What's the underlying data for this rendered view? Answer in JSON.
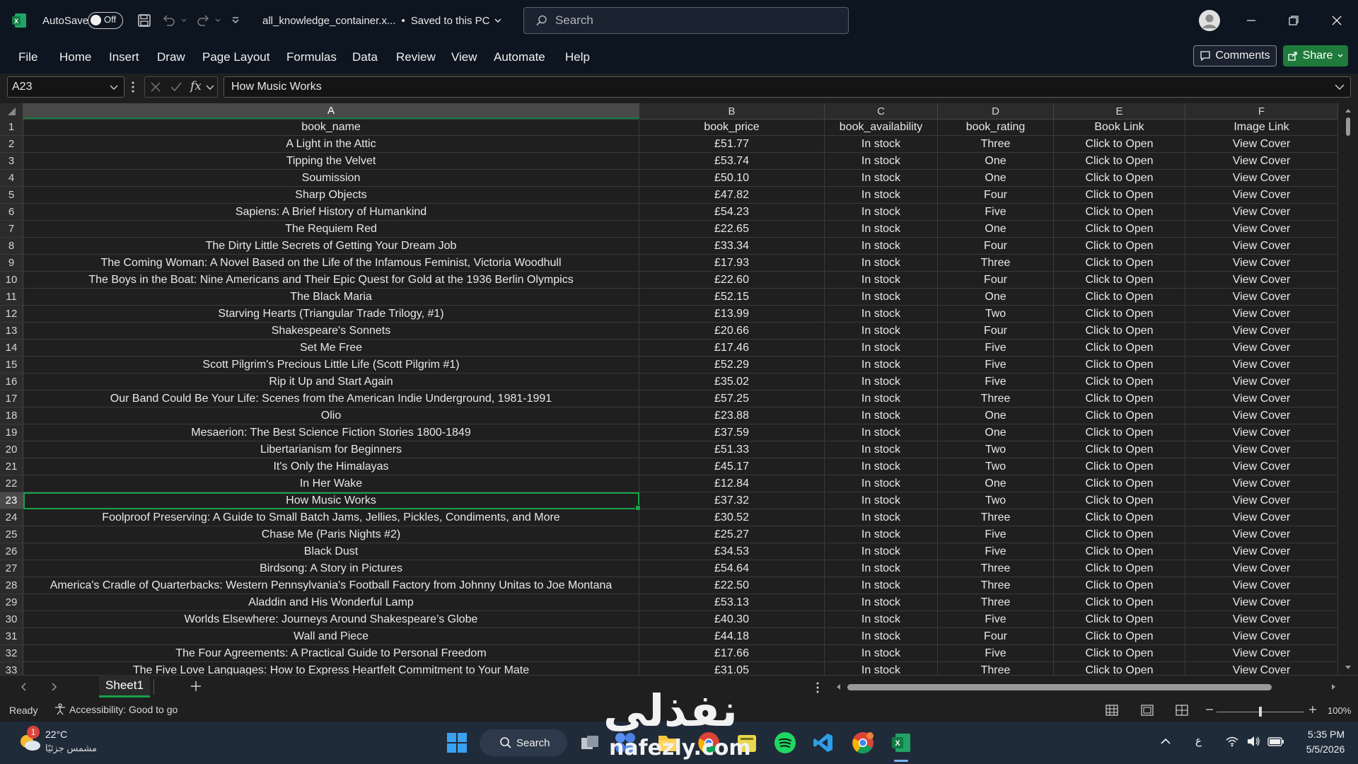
{
  "titlebar": {
    "autosave_label": "AutoSave",
    "autosave_state": "Off",
    "file_name": "all_knowledge_container.x...",
    "save_status": "Saved to this PC",
    "search_placeholder": "Search"
  },
  "ribbon": {
    "tabs": [
      "File",
      "Home",
      "Insert",
      "Draw",
      "Page Layout",
      "Formulas",
      "Data",
      "Review",
      "View",
      "Automate",
      "Help"
    ],
    "comments_label": "Comments",
    "share_label": "Share"
  },
  "formula_bar": {
    "name_box": "A23",
    "fx_label": "fx",
    "content": "How Music Works"
  },
  "grid": {
    "columns": [
      "A",
      "B",
      "C",
      "D",
      "E",
      "F"
    ],
    "selected_column": "A",
    "selected_row": 23,
    "rows": [
      {
        "n": "1",
        "a": "book_name",
        "b": "book_price",
        "c": "book_availability",
        "d": "book_rating",
        "e": "Book Link",
        "f": "Image Link"
      },
      {
        "n": "2",
        "a": "A Light in the Attic",
        "b": "£51.77",
        "c": "In stock",
        "d": "Three",
        "e": "Click to Open",
        "f": "View Cover"
      },
      {
        "n": "3",
        "a": "Tipping the Velvet",
        "b": "£53.74",
        "c": "In stock",
        "d": "One",
        "e": "Click to Open",
        "f": "View Cover"
      },
      {
        "n": "4",
        "a": "Soumission",
        "b": "£50.10",
        "c": "In stock",
        "d": "One",
        "e": "Click to Open",
        "f": "View Cover"
      },
      {
        "n": "5",
        "a": "Sharp Objects",
        "b": "£47.82",
        "c": "In stock",
        "d": "Four",
        "e": "Click to Open",
        "f": "View Cover"
      },
      {
        "n": "6",
        "a": "Sapiens: A Brief History of Humankind",
        "b": "£54.23",
        "c": "In stock",
        "d": "Five",
        "e": "Click to Open",
        "f": "View Cover"
      },
      {
        "n": "7",
        "a": "The Requiem Red",
        "b": "£22.65",
        "c": "In stock",
        "d": "One",
        "e": "Click to Open",
        "f": "View Cover"
      },
      {
        "n": "8",
        "a": "The Dirty Little Secrets of Getting Your Dream Job",
        "b": "£33.34",
        "c": "In stock",
        "d": "Four",
        "e": "Click to Open",
        "f": "View Cover"
      },
      {
        "n": "9",
        "a": "The Coming Woman: A Novel Based on the Life of the Infamous Feminist, Victoria Woodhull",
        "b": "£17.93",
        "c": "In stock",
        "d": "Three",
        "e": "Click to Open",
        "f": "View Cover"
      },
      {
        "n": "10",
        "a": "The Boys in the Boat: Nine Americans and Their Epic Quest for Gold at the 1936 Berlin Olympics",
        "b": "£22.60",
        "c": "In stock",
        "d": "Four",
        "e": "Click to Open",
        "f": "View Cover"
      },
      {
        "n": "11",
        "a": "The Black Maria",
        "b": "£52.15",
        "c": "In stock",
        "d": "One",
        "e": "Click to Open",
        "f": "View Cover"
      },
      {
        "n": "12",
        "a": "Starving Hearts (Triangular Trade Trilogy, #1)",
        "b": "£13.99",
        "c": "In stock",
        "d": "Two",
        "e": "Click to Open",
        "f": "View Cover"
      },
      {
        "n": "13",
        "a": "Shakespeare's Sonnets",
        "b": "£20.66",
        "c": "In stock",
        "d": "Four",
        "e": "Click to Open",
        "f": "View Cover"
      },
      {
        "n": "14",
        "a": "Set Me Free",
        "b": "£17.46",
        "c": "In stock",
        "d": "Five",
        "e": "Click to Open",
        "f": "View Cover"
      },
      {
        "n": "15",
        "a": "Scott Pilgrim's Precious Little Life (Scott Pilgrim #1)",
        "b": "£52.29",
        "c": "In stock",
        "d": "Five",
        "e": "Click to Open",
        "f": "View Cover"
      },
      {
        "n": "16",
        "a": "Rip it Up and Start Again",
        "b": "£35.02",
        "c": "In stock",
        "d": "Five",
        "e": "Click to Open",
        "f": "View Cover"
      },
      {
        "n": "17",
        "a": "Our Band Could Be Your Life: Scenes from the American Indie Underground, 1981-1991",
        "b": "£57.25",
        "c": "In stock",
        "d": "Three",
        "e": "Click to Open",
        "f": "View Cover"
      },
      {
        "n": "18",
        "a": "Olio",
        "b": "£23.88",
        "c": "In stock",
        "d": "One",
        "e": "Click to Open",
        "f": "View Cover"
      },
      {
        "n": "19",
        "a": "Mesaerion: The Best Science Fiction Stories 1800-1849",
        "b": "£37.59",
        "c": "In stock",
        "d": "One",
        "e": "Click to Open",
        "f": "View Cover"
      },
      {
        "n": "20",
        "a": "Libertarianism for Beginners",
        "b": "£51.33",
        "c": "In stock",
        "d": "Two",
        "e": "Click to Open",
        "f": "View Cover"
      },
      {
        "n": "21",
        "a": "It's Only the Himalayas",
        "b": "£45.17",
        "c": "In stock",
        "d": "Two",
        "e": "Click to Open",
        "f": "View Cover"
      },
      {
        "n": "22",
        "a": "In Her Wake",
        "b": "£12.84",
        "c": "In stock",
        "d": "One",
        "e": "Click to Open",
        "f": "View Cover"
      },
      {
        "n": "23",
        "a": "How Music Works",
        "b": "£37.32",
        "c": "In stock",
        "d": "Two",
        "e": "Click to Open",
        "f": "View Cover"
      },
      {
        "n": "24",
        "a": "Foolproof Preserving: A Guide to Small Batch Jams, Jellies, Pickles, Condiments, and More",
        "b": "£30.52",
        "c": "In stock",
        "d": "Three",
        "e": "Click to Open",
        "f": "View Cover"
      },
      {
        "n": "25",
        "a": "Chase Me (Paris Nights #2)",
        "b": "£25.27",
        "c": "In stock",
        "d": "Five",
        "e": "Click to Open",
        "f": "View Cover"
      },
      {
        "n": "26",
        "a": "Black Dust",
        "b": "£34.53",
        "c": "In stock",
        "d": "Five",
        "e": "Click to Open",
        "f": "View Cover"
      },
      {
        "n": "27",
        "a": "Birdsong: A Story in Pictures",
        "b": "£54.64",
        "c": "In stock",
        "d": "Three",
        "e": "Click to Open",
        "f": "View Cover"
      },
      {
        "n": "28",
        "a": "America's Cradle of Quarterbacks: Western Pennsylvania's Football Factory from Johnny Unitas to Joe Montana",
        "b": "£22.50",
        "c": "In stock",
        "d": "Three",
        "e": "Click to Open",
        "f": "View Cover"
      },
      {
        "n": "29",
        "a": "Aladdin and His Wonderful Lamp",
        "b": "£53.13",
        "c": "In stock",
        "d": "Three",
        "e": "Click to Open",
        "f": "View Cover"
      },
      {
        "n": "30",
        "a": "Worlds Elsewhere: Journeys Around Shakespeare’s Globe",
        "b": "£40.30",
        "c": "In stock",
        "d": "Five",
        "e": "Click to Open",
        "f": "View Cover"
      },
      {
        "n": "31",
        "a": "Wall and Piece",
        "b": "£44.18",
        "c": "In stock",
        "d": "Four",
        "e": "Click to Open",
        "f": "View Cover"
      },
      {
        "n": "32",
        "a": "The Four Agreements: A Practical Guide to Personal Freedom",
        "b": "£17.66",
        "c": "In stock",
        "d": "Five",
        "e": "Click to Open",
        "f": "View Cover"
      },
      {
        "n": "33",
        "a": "The Five Love Languages: How to Express Heartfelt Commitment to Your Mate",
        "b": "£31.05",
        "c": "In stock",
        "d": "Three",
        "e": "Click to Open",
        "f": "View Cover"
      }
    ]
  },
  "sheets": {
    "active": "Sheet1"
  },
  "status": {
    "mode": "Ready",
    "accessibility": "Accessibility: Good to go",
    "zoom": "100%"
  },
  "taskbar": {
    "weather_temp": "22°C",
    "weather_desc": "مشمس جزئيًا",
    "weather_badge": "1",
    "search_label": "Search",
    "lang": "ع",
    "time": "5:35 PM",
    "date": "5/5/2026"
  },
  "watermark": {
    "text_ar": "نفذلى",
    "text_en": "nafezly.com"
  },
  "colors": {
    "excel_green": "#107c41",
    "share_green": "#1e7b3c",
    "selection_green": "#16a34a"
  }
}
